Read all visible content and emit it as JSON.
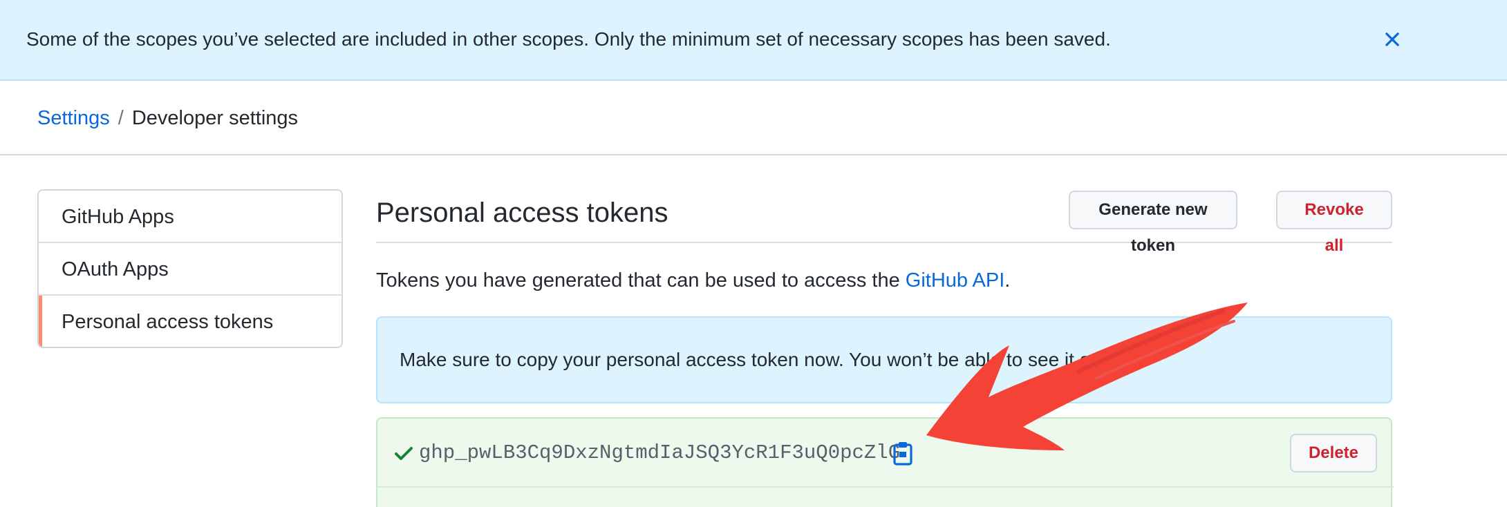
{
  "flash": {
    "message": "Some of the scopes you’ve selected are included in other scopes. Only the minimum set of necessary scopes has been saved.",
    "close_icon": "close-icon"
  },
  "breadcrumb": {
    "settings": "Settings",
    "separator": "/",
    "current": "Developer settings"
  },
  "sidebar": {
    "items": [
      {
        "label": "GitHub Apps"
      },
      {
        "label": "OAuth Apps"
      },
      {
        "label": "Personal access tokens",
        "selected": true
      }
    ]
  },
  "main": {
    "title": "Personal access tokens",
    "generate_label": "Generate new token",
    "revoke_label": "Revoke all",
    "description_prefix": "Tokens you have generated that can be used to access the ",
    "description_link": "GitHub API",
    "description_suffix": ".",
    "notice": "Make sure to copy your personal access token now. You won’t be able to see it again!",
    "token": {
      "value": "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",
      "delete_label": "Delete",
      "status_icon": "check-icon",
      "copy_icon": "clipboard-icon"
    }
  },
  "colors": {
    "accent": "#0969da",
    "danger": "#cf222e",
    "success": "#1a7f37",
    "flash_bg": "#ddf4ff",
    "token_bg": "#eef9ee",
    "selected_marker": "#fd8c73",
    "annotation_arrow": "#f44336"
  }
}
